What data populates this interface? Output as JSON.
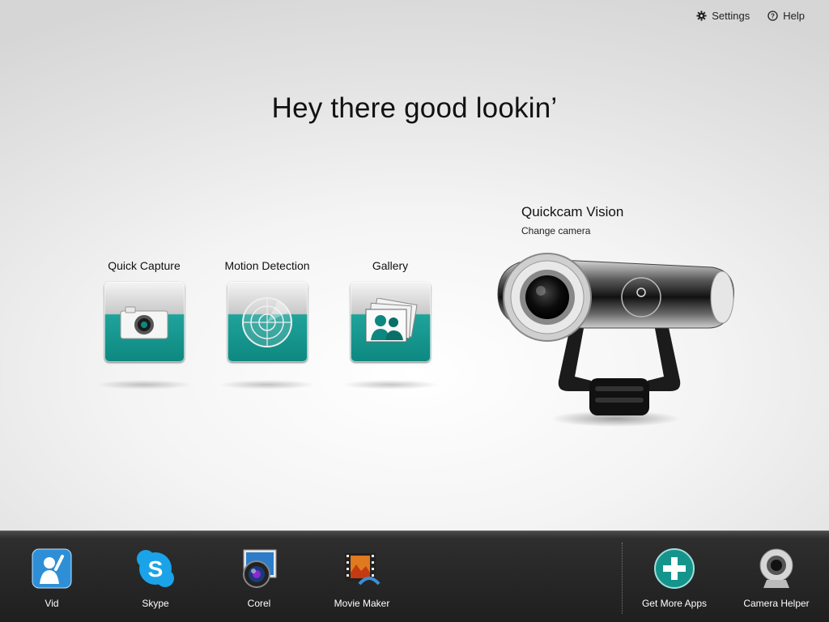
{
  "top_links": {
    "settings": "Settings",
    "help": "Help"
  },
  "headline": "Hey there good lookin’",
  "tiles": [
    {
      "label": "Quick Capture",
      "icon": "camera-icon"
    },
    {
      "label": "Motion Detection",
      "icon": "radar-icon"
    },
    {
      "label": "Gallery",
      "icon": "photos-icon"
    }
  ],
  "camera": {
    "name": "Quickcam Vision",
    "action": "Change camera"
  },
  "dock": [
    {
      "label": "Vid",
      "icon": "vid-icon"
    },
    {
      "label": "Skype",
      "icon": "skype-icon"
    },
    {
      "label": "Corel",
      "icon": "corel-icon"
    },
    {
      "label": "Movie Maker",
      "icon": "movie-maker-icon"
    },
    {
      "label": "Get More Apps",
      "icon": "plus-icon"
    },
    {
      "label": "Camera Helper",
      "icon": "webcam-icon"
    }
  ],
  "colors": {
    "accent": "#0d8880",
    "dock_bg": "#1f1f1f"
  }
}
